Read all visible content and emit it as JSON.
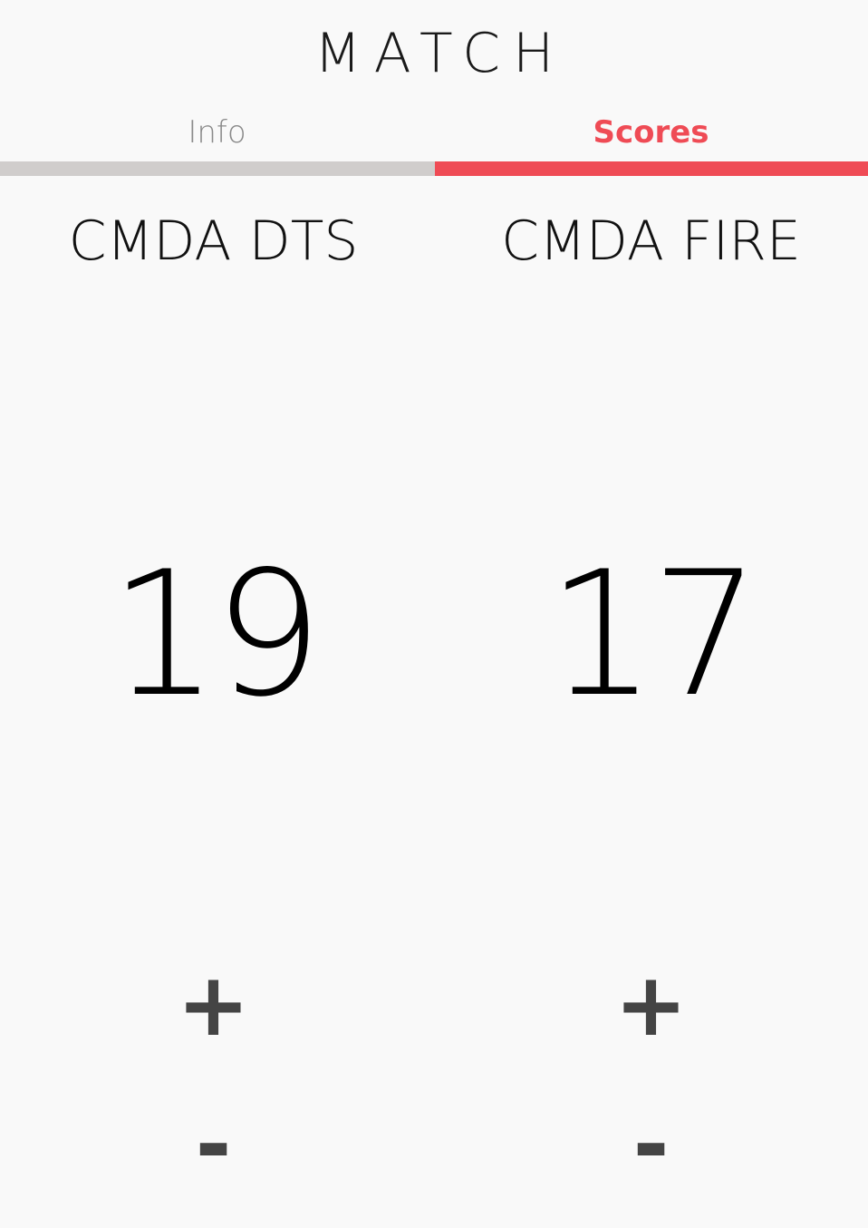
{
  "header": {
    "title": "MATCH"
  },
  "tabs": [
    {
      "label": "Info",
      "active": false
    },
    {
      "label": "Scores",
      "active": true
    }
  ],
  "colors": {
    "background": "#f9f9f9",
    "accent": "#ef4b55",
    "inactive_tab_bar": "#d0cdcc",
    "inactive_tab_text": "#8a8a8a",
    "button_text": "#444444"
  },
  "teams": [
    {
      "name": "CMDA DTS",
      "score": "19",
      "increment_label": "+",
      "decrement_label": "-"
    },
    {
      "name": "CMDA FIRE",
      "score": "17",
      "increment_label": "+",
      "decrement_label": "-"
    }
  ]
}
